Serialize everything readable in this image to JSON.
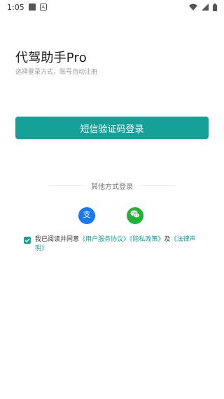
{
  "status_bar": {
    "time": "1:05"
  },
  "header": {
    "title": "代驾助手Pro",
    "subtitle": "选择登录方式，账号自动注册"
  },
  "login": {
    "sms_button_label": "短信验证码登录"
  },
  "other_methods": {
    "label": "其他方式登录"
  },
  "agreement": {
    "prefix": "我已阅读并同意",
    "user_service_agreement": "《用户服务协议》",
    "privacy_policy": "《隐私政策》",
    "and": "及",
    "legal_statement": "《法律声明》",
    "checked": true
  },
  "colors": {
    "accent": "#16a198",
    "alipay": "#1677ff",
    "wechat": "#21b334"
  },
  "icons": {
    "alipay": "alipay-icon",
    "wechat": "wechat-icon"
  }
}
